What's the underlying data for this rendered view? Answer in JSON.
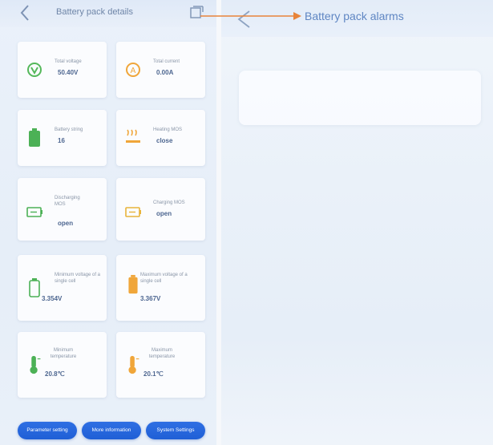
{
  "left_screen": {
    "title": "Battery pack details",
    "cards": [
      {
        "label": "Total voltage",
        "value": "50.40V",
        "icon": "voltage-icon"
      },
      {
        "label": "Total current",
        "value": "0.00A",
        "icon": "current-icon"
      },
      {
        "label": "Battery string",
        "value": "16",
        "icon": "battery-icon"
      },
      {
        "label": "Heating MOS",
        "value": "close",
        "icon": "heating-icon"
      },
      {
        "label": "Discharging MOS",
        "value": "open",
        "icon": "discharge-icon"
      },
      {
        "label": "Charging MOS",
        "value": "open",
        "icon": "charge-icon"
      },
      {
        "label": "Minimum voltage of a single cell",
        "value": "3.354V",
        "icon": "min-cell-icon"
      },
      {
        "label": "Maximum voltage of a single cell",
        "value": "3.367V",
        "icon": "max-cell-icon"
      },
      {
        "label": "Minimum temperature",
        "value": "20.8℃",
        "icon": "min-temp-icon"
      },
      {
        "label": "Maximum temperature",
        "value": "20.1℃",
        "icon": "max-temp-icon"
      }
    ],
    "buttons": {
      "parameter": "Parameter setting",
      "more": "More information",
      "system": "System Settings"
    }
  },
  "right_screen": {
    "title": "Battery pack alarms"
  },
  "colors": {
    "accent_blue": "#2f6fe3",
    "value_text": "#4d6690",
    "annotation_arrow": "#e8843a"
  }
}
